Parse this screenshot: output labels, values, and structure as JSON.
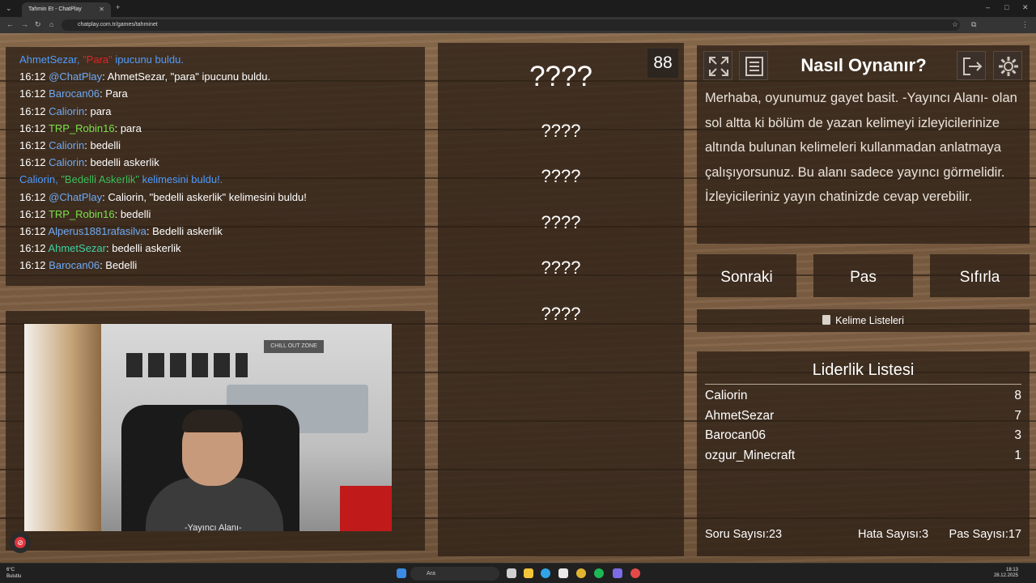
{
  "browser": {
    "tab_title": "Tahmin Et - ChatPlay",
    "url": "chatplay.com.tr/games/tahminet"
  },
  "chat": {
    "lines": [
      {
        "kind": "sys",
        "name": "AhmetSezar,",
        "highlight": "\"Para\"",
        "rest": " ipucunu buldu."
      },
      {
        "kind": "msg",
        "time": "16:12",
        "user": "@ChatPlay",
        "color": "blue",
        "text": ": AhmetSezar, \"para\" ipucunu buldu."
      },
      {
        "kind": "msg",
        "time": "16:12",
        "user": "Barocan06",
        "color": "blue",
        "text": ": Para"
      },
      {
        "kind": "msg",
        "time": "16:12",
        "user": "Caliorin",
        "color": "blue",
        "text": ": para"
      },
      {
        "kind": "msg",
        "time": "16:12",
        "user": "TRP_Robin16",
        "color": "green",
        "text": ": para"
      },
      {
        "kind": "msg",
        "time": "16:12",
        "user": "Caliorin",
        "color": "blue",
        "text": ": bedelli"
      },
      {
        "kind": "msg",
        "time": "16:12",
        "user": "Caliorin",
        "color": "blue",
        "text": ": bedelli askerlik"
      },
      {
        "kind": "sys2",
        "name": "Caliorin,",
        "highlight": "\"Bedelli Askerlik\"",
        "rest": " kelimesini buldu!."
      },
      {
        "kind": "msg",
        "time": "16:12",
        "user": "@ChatPlay",
        "color": "blue",
        "text": ": Caliorin, \"bedelli askerlik\" kelimesini buldu!"
      },
      {
        "kind": "msg",
        "time": "16:12",
        "user": "TRP_Robin16",
        "color": "green",
        "text": ": bedelli"
      },
      {
        "kind": "msg",
        "time": "16:12",
        "user": "Alperus1881rafasilva",
        "color": "blue",
        "text": ": Bedelli askerlik"
      },
      {
        "kind": "msg",
        "time": "16:12",
        "user": "AhmetSezar",
        "color": "teal",
        "text": ": bedelli askerlik"
      },
      {
        "kind": "msg",
        "time": "16:12",
        "user": "Barocan06",
        "color": "blue",
        "text": ": Bedelli"
      }
    ]
  },
  "camera": {
    "label": "-Yayıncı Alanı-",
    "sign": "CHILL OUT ZONE"
  },
  "words": {
    "timer": "88",
    "main": "????",
    "taboo": [
      "????",
      "????",
      "????",
      "????",
      "????"
    ]
  },
  "info": {
    "title": "Nasıl Oynanır?",
    "text": "Merhaba, oyunumuz gayet basit. -Yayıncı Alanı- olan sol altta ki bölüm de yazan kelimeyi izleyicilerinize altında bulunan kelimeleri kullanmadan anlatmaya çalışıyorsunuz. Bu alanı sadece yayıncı görmelidir. İzleyicileriniz yayın chatinizde cevap verebilir."
  },
  "buttons": {
    "next": "Sonraki",
    "pass": "Pas",
    "reset": "Sıfırla"
  },
  "word_lists": "Kelime Listeleri",
  "leaderboard": {
    "title": "Liderlik Listesi",
    "rows": [
      {
        "name": "Caliorin",
        "score": "8"
      },
      {
        "name": "AhmetSezar",
        "score": "7"
      },
      {
        "name": "Barocan06",
        "score": "3"
      },
      {
        "name": "ozgur_Minecraft",
        "score": "1"
      }
    ]
  },
  "stats": {
    "questions": "Soru Sayısı:23",
    "errors": "Hata Sayısı:3",
    "passes": "Pas Sayısı:17"
  },
  "taskbar": {
    "weather_temp": "6°C",
    "weather_desc": "Bulutlu",
    "search": "Ara",
    "time": "18:13",
    "date": "28.12.2025"
  },
  "colors": {
    "chat_blue": "#6ea9f2",
    "chat_green": "#7be04a",
    "chat_teal": "#3fd0a0",
    "system_blue": "#4f9cff",
    "highlight_red": "#e02424"
  }
}
